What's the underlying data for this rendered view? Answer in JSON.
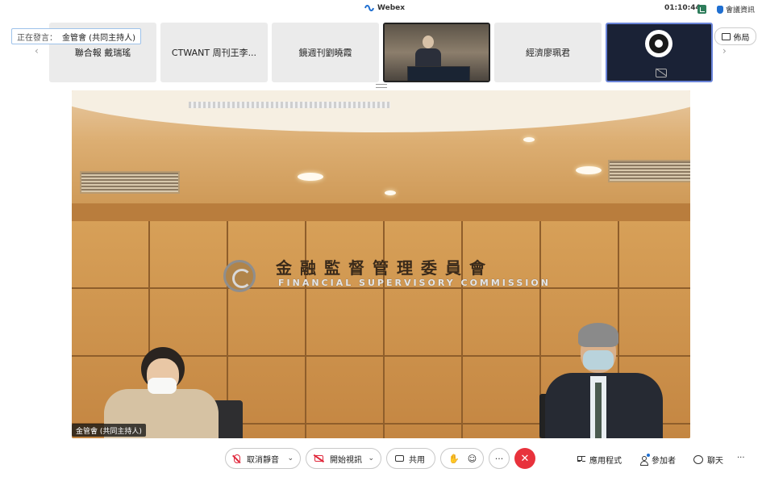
{
  "window": {
    "app_title": "Webex",
    "clock": "01:10:44",
    "meeting_info": "會議資訊"
  },
  "speaking": {
    "label": "正在發言：",
    "name": "金管會 (共同主持人)"
  },
  "filmstrip": {
    "tiles": [
      {
        "name": "聯合報 戴瑞瑤"
      },
      {
        "name": "CTWANT 周刊王李..."
      },
      {
        "name": "鏡週刊劉曉霞"
      },
      {
        "name": ""
      },
      {
        "name": "經濟廖珮君"
      },
      {
        "name": ""
      }
    ],
    "prev_arrow": "‹",
    "next_arrow": "›",
    "layout_label": "佈局"
  },
  "main_video": {
    "wall_sign_cn": "金融監督管理委員會",
    "wall_sign_en": "FINANCIAL SUPERVISORY COMMISSION",
    "name_tag": "金管會 (共同主持人)"
  },
  "controls": {
    "mute_label": "取消靜音",
    "video_label": "開始視訊",
    "share_label": "共用",
    "more_label": "···",
    "hangup_label": "✕",
    "apps_label": "應用程式",
    "participants_label": "參加者",
    "chat_label": "聊天",
    "overflow_label": "···"
  },
  "colors": {
    "hangup": "#e8323c",
    "muted_icon": "#e0283c",
    "accent": "#1f6fd1"
  }
}
